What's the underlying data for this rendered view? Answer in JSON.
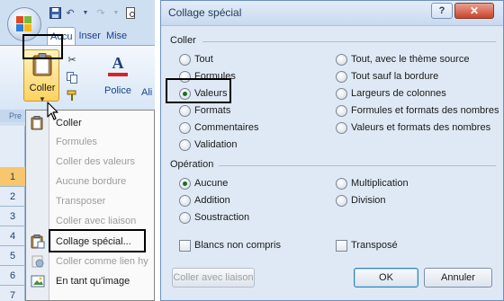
{
  "ribbon": {
    "tabs": [
      {
        "label": "Accu"
      },
      {
        "label": "Inser"
      },
      {
        "label": "Mise"
      }
    ],
    "paste_label": "Coller",
    "font_label": "Police",
    "align_label": "Ali",
    "group_label": "Pre",
    "font_letter": "A"
  },
  "rows": [
    "1",
    "2",
    "3",
    "4",
    "5",
    "6",
    "7"
  ],
  "paste_menu": {
    "items": [
      {
        "label": "Coller",
        "enabled": true
      },
      {
        "label": "Formules",
        "enabled": false
      },
      {
        "label": "Coller des valeurs",
        "enabled": false
      },
      {
        "label": "Aucune bordure",
        "enabled": false
      },
      {
        "label": "Transposer",
        "enabled": false
      },
      {
        "label": "Coller avec liaison",
        "enabled": false
      },
      {
        "label": "Collage spécial...",
        "enabled": true
      },
      {
        "label": "Coller comme lien hy",
        "enabled": false
      },
      {
        "label": "En tant qu'image",
        "enabled": true
      }
    ]
  },
  "dialog": {
    "title": "Collage spécial",
    "help": "?",
    "close": "✕",
    "coller_section": "Coller",
    "paste_options_left": [
      {
        "label": "Tout",
        "selected": false
      },
      {
        "label": "Formules",
        "selected": false
      },
      {
        "label": "Valeurs",
        "selected": true
      },
      {
        "label": "Formats",
        "selected": false
      },
      {
        "label": "Commentaires",
        "selected": false
      },
      {
        "label": "Validation",
        "selected": false
      }
    ],
    "paste_options_right": [
      {
        "label": "Tout, avec le thème source",
        "selected": false
      },
      {
        "label": "Tout sauf la bordure",
        "selected": false
      },
      {
        "label": "Largeurs de colonnes",
        "selected": false
      },
      {
        "label": "Formules et formats des nombres",
        "selected": false
      },
      {
        "label": "Valeurs et formats des nombres",
        "selected": false
      }
    ],
    "operation_section": "Opération",
    "operation_left": [
      {
        "label": "Aucune",
        "selected": true
      },
      {
        "label": "Addition",
        "selected": false
      },
      {
        "label": "Soustraction",
        "selected": false
      }
    ],
    "operation_right": [
      {
        "label": "Multiplication",
        "selected": false
      },
      {
        "label": "Division",
        "selected": false
      }
    ],
    "skip_blanks": "Blancs non compris",
    "transpose": "Transposé",
    "paste_link_button": "Coller avec liaison",
    "ok_button": "OK",
    "cancel_button": "Annuler"
  }
}
